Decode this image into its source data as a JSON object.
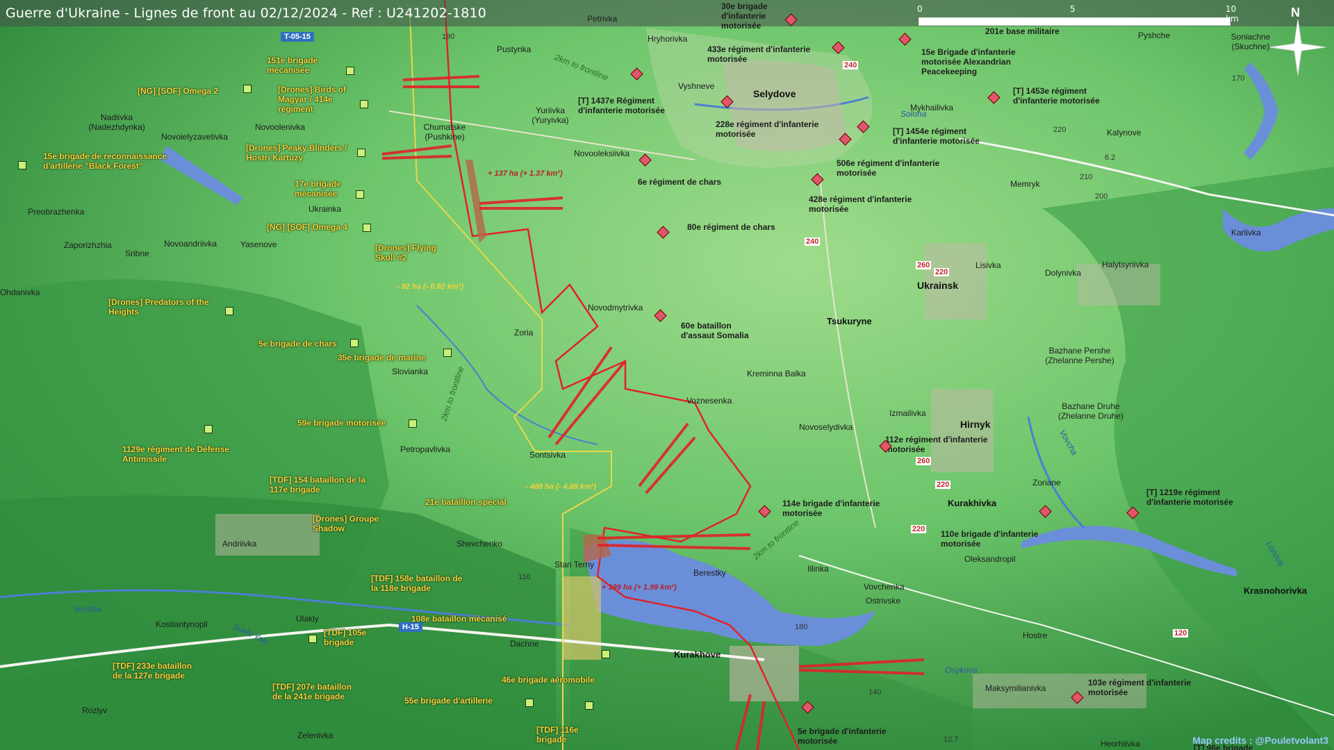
{
  "title": "Guerre d'Ukraine - Lignes de front au 02/12/2024 - Ref : U241202-1810",
  "scale": {
    "zero": "0",
    "mid": "5",
    "end": "10 km"
  },
  "north": "N",
  "credits": "Map credits : @Pouletvolant3",
  "colors": {
    "front_line": "#e0222a",
    "russian_unit": "#e0566a",
    "ukrainian_unit_text": "#f2d23a",
    "water": "#6a8fd8"
  },
  "ukrainian_units": [
    "151e brigade mécanisée",
    "[NG] [SOF] Omega 2",
    "[Drones] Birds of Magyar / 414e régiment",
    "15e brigade de reconnaissance d'artillerie \"Black Forest\"",
    "[Drones] Peaky Blinders / Hostri Kartuzy",
    "17e brigade mécanisée",
    "[NG] [SOF] Omega 4",
    "[Drones] Flying Skull #2",
    "[Drones] Predators of the Heights",
    "5e brigade de chars",
    "35e brigade de marine",
    "59e brigade motorisée",
    "1129e régiment de Défense Antimissile",
    "[TDF] 154 bataillon de la 117e brigade",
    "21e bataillon spécial",
    "[Drones] Groupe Shadow",
    "[TDF] 158e bataillon de la 118e brigade",
    "108e bataillon mécanisé",
    "[TDF] 105e brigade",
    "[TDF] 233e bataillon de la 127e brigade",
    "[TDF] 207e bataillon de la 241e brigade",
    "46e brigade aéromobile",
    "55e brigade d'artillerie",
    "[TDF] 116e brigade"
  ],
  "russian_units": [
    "30e brigade d'infanterie motorisée",
    "201e base militaire",
    "433e régiment d'infanterie motorisée",
    "15e Brigade d'infanterie motorisée Alexandrian Peacekeeping",
    "[T] 1437e Régiment d'infanterie motorisée",
    "228e régiment d'infanterie motorisée",
    "[T] 1453e régiment d'infanterie motorisée",
    "[T] 1454e régiment d'infanterie motorisée",
    "506e régiment d'infanterie motorisée",
    "6e régiment de chars",
    "428e régiment d'infanterie motorisée",
    "80e régiment de chars",
    "60e bataillon d'assaut Somalia",
    "112e régiment d'infanterie motorisée",
    "114e brigade d'infanterie motorisée",
    "110e brigade d'infanterie motorisée",
    "[T] 1219e régiment d'infanterie motorisée",
    "103e régiment d'infanterie motorisée",
    "5e brigade d'infanterie motorisée",
    "[T] 96e brigade"
  ],
  "towns": [
    "Petrivka",
    "Hryhorivka",
    "Pustynka",
    "Vyshneve",
    "Selydove",
    "Pyshche",
    "Soniachne (Skuchne)",
    "Nadiivka (Nadezhdynka)",
    "Novoielyzavetivka",
    "Novoolenivka",
    "Chumatske (Pushkine)",
    "Yuriivka (Yuryivka)",
    "Mykhailivka",
    "Novooleksiivka",
    "Kalynove",
    "Memryk",
    "Karlivka",
    "Preobrazhenka",
    "Ukrainka",
    "Zaporizhzhia",
    "Sribne",
    "Novoandriivka",
    "Yasenove",
    "Lisivka",
    "Dolynivka",
    "Halytsynivka",
    "Ukrainsk",
    "Tsukuryne",
    "Novodmytrivka",
    "Zoria",
    "Slovianka",
    "Kreminna Balka",
    "Bazhane Pershe (Zhelanne Pershe)",
    "Voznesenka",
    "Novoselydivka",
    "Izmailivka",
    "Hirnyk",
    "Bazhane Druhe (Zhelanne Druhe)",
    "Petropavlivka",
    "Sontsivka",
    "Zoriane",
    "Kurakhivka",
    "Shevchenko",
    "Stari Terny",
    "Berestky",
    "Oleksandropil",
    "Illinka",
    "Andriivka",
    "Vovchenka",
    "Ostrivske",
    "Krasnohorivka",
    "Kostiantynopil",
    "Ulakly",
    "Dachne",
    "Kurakhove",
    "Hostre",
    "Maksymilianivka",
    "Rozlyv",
    "Zelenivka",
    "Heorhiivka",
    "Ohdanivka"
  ],
  "rivers": [
    "Vovcha",
    "Sukhi Yaly",
    "Osykova",
    "Solona",
    "Vovcha",
    "Lozova"
  ],
  "roads": [
    "T-05-15",
    "H-15"
  ],
  "road_numbers": [
    "190",
    "240",
    "170",
    "220",
    "210",
    "200",
    "260",
    "110",
    "120",
    "180",
    "140",
    "12.7",
    "6.2"
  ],
  "front_notes": [
    "2km to frontline",
    "2km to frontline",
    "2km to frontline"
  ],
  "area_changes": [
    "+ 137 ha (+ 1.37 km²)",
    "- 92 ha (- 0.92 km²)",
    "- 488 ha (- 4.88 km²)",
    "+ 199 ha (+ 1.99 km²)"
  ]
}
